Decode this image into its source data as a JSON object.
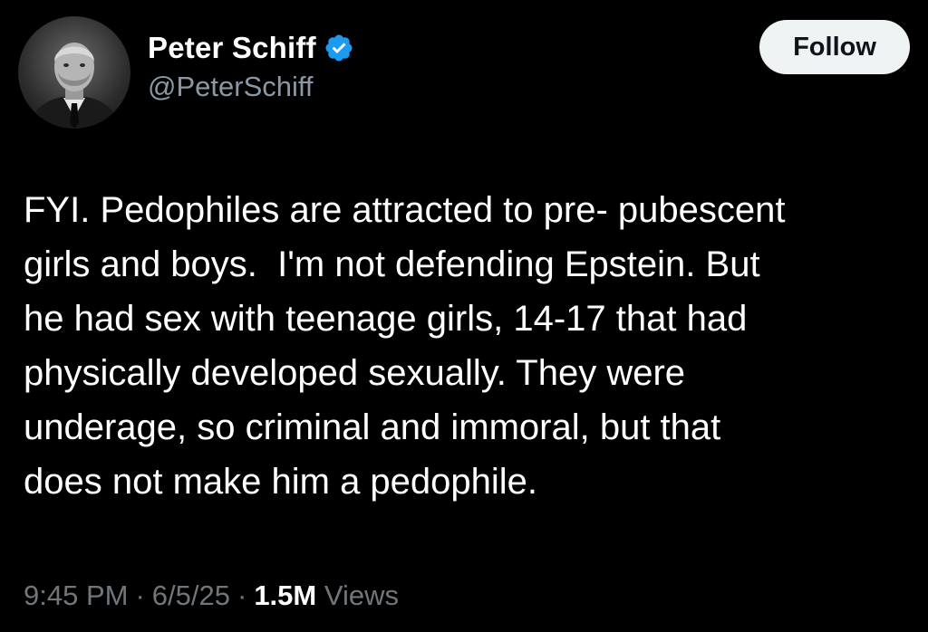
{
  "author": {
    "display_name": "Peter Schiff",
    "handle": "@PeterSchiff",
    "verified": true
  },
  "follow_button": {
    "label": "Follow"
  },
  "tweet": {
    "lines": [
      "FYI. Pedophiles are attracted to pre- pubescent",
      "girls and boys.  I'm not defending Epstein. But",
      "he had sex with teenage girls, 14-17 that had",
      "physically developed sexually. They were",
      "underage, so criminal and immoral, but that",
      "does not make him a pedophile."
    ]
  },
  "meta": {
    "time": "9:45 PM",
    "separator": "·",
    "date": "6/5/25",
    "views_count": "1.5M",
    "views_label": "Views"
  },
  "colors": {
    "background": "#000000",
    "text_primary": "#ffffff",
    "text_secondary": "#8b98a5",
    "verified_badge": "#1d9bf0",
    "follow_button_bg": "#eff3f4"
  }
}
